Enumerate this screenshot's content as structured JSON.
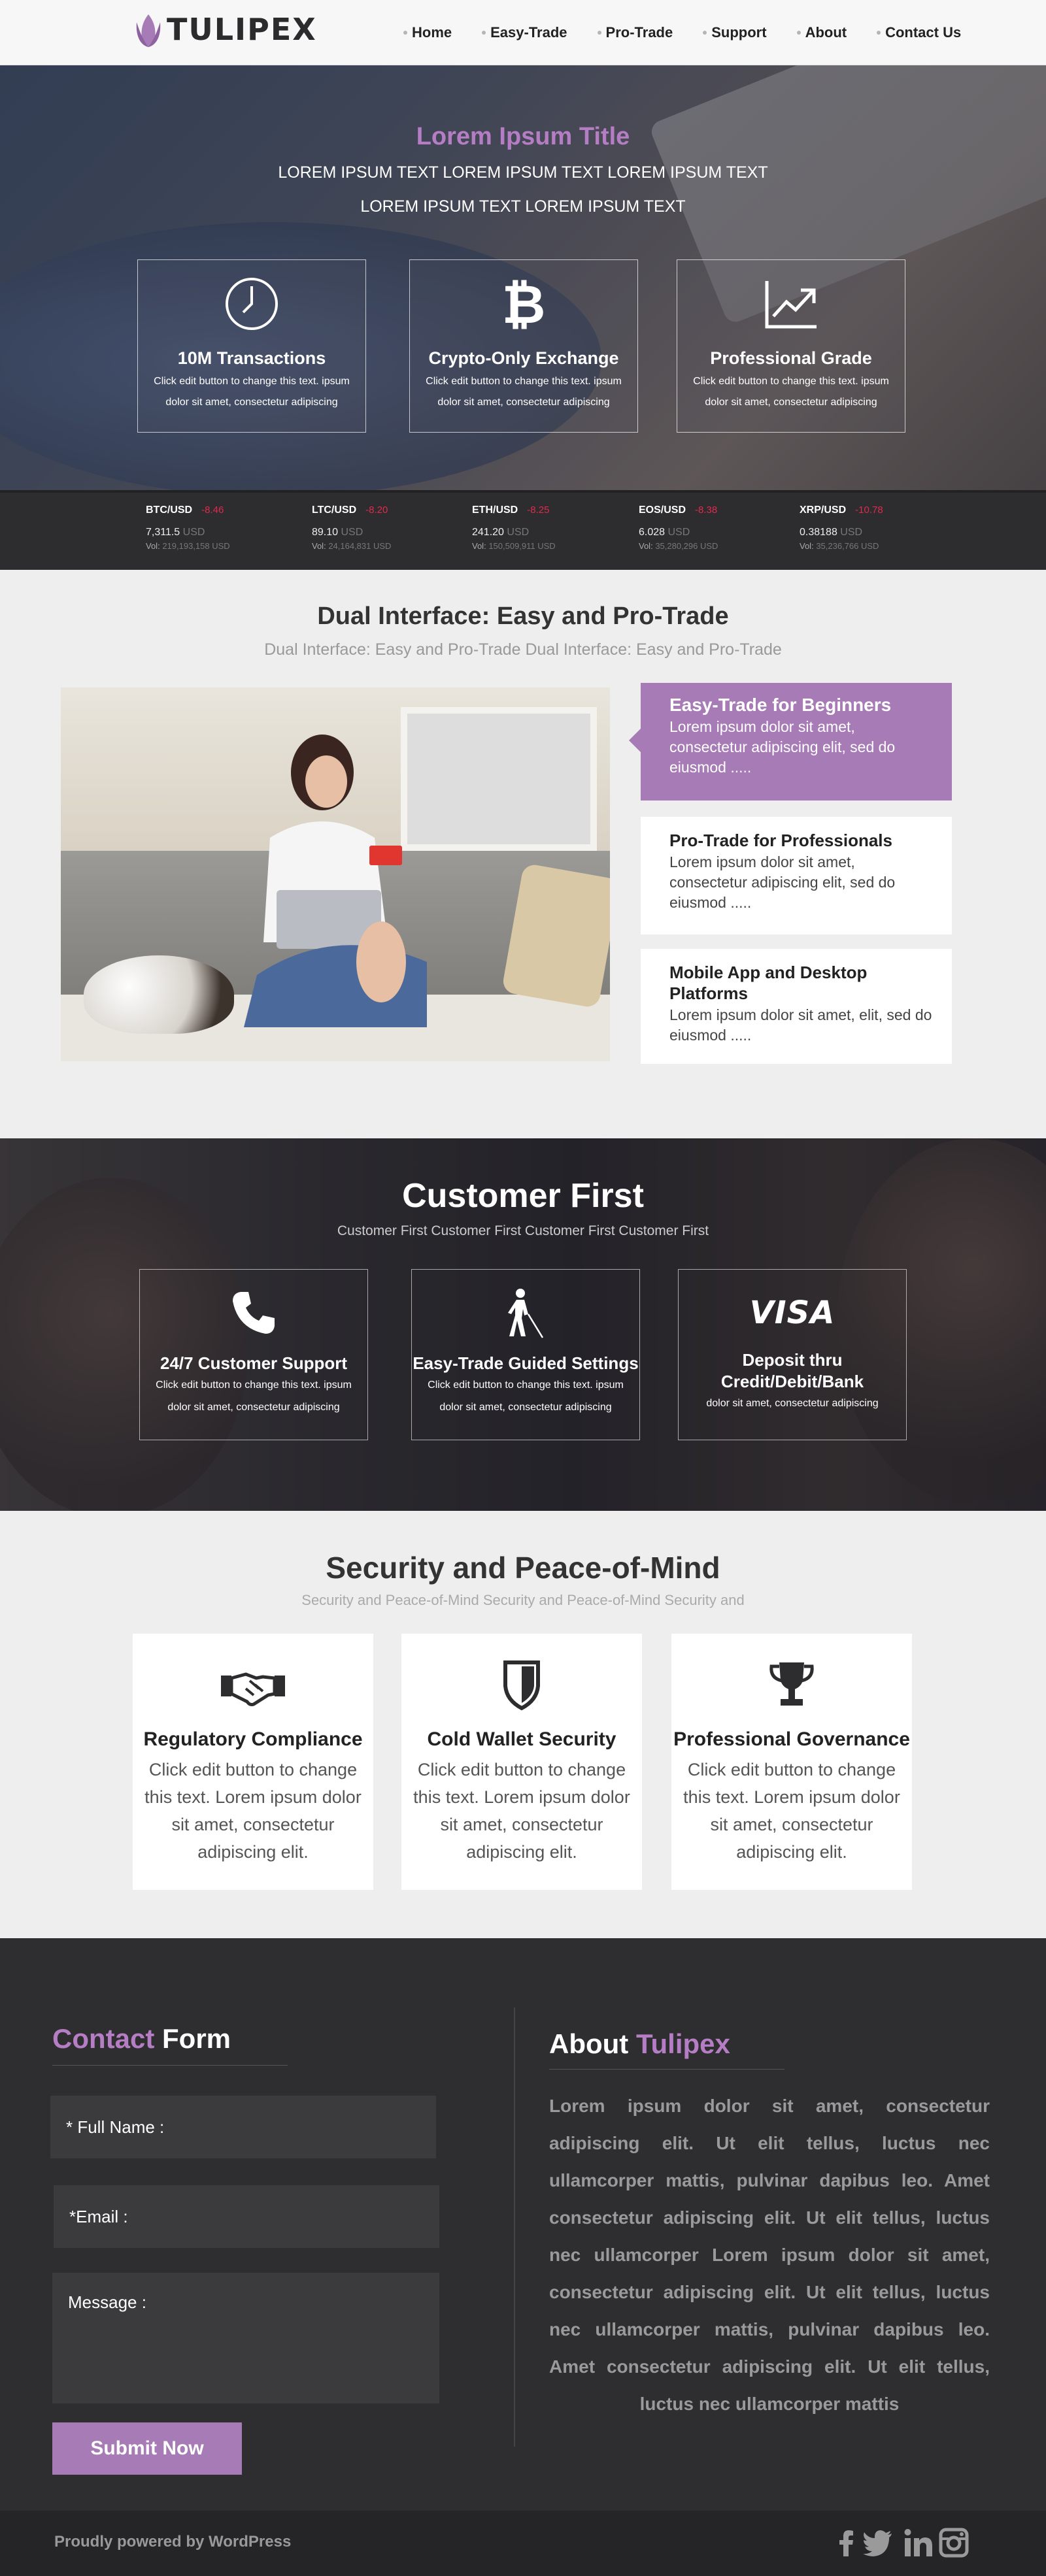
{
  "header": {
    "logo_text": "TULIPEX",
    "nav": [
      "Home",
      "Easy-Trade",
      "Pro-Trade",
      "Support",
      "About",
      "Contact Us"
    ]
  },
  "hero": {
    "title": "Lorem Ipsum Title",
    "line1": "LOREM IPSUM TEXT LOREM IPSUM TEXT LOREM IPSUM TEXT",
    "line2": "LOREM IPSUM TEXT  LOREM IPSUM TEXT",
    "features": [
      {
        "icon": "clock-icon",
        "title": "10M Transactions",
        "desc": "Click edit button to change this text. ipsum dolor sit amet, consectetur adipiscing"
      },
      {
        "icon": "bitcoin-icon",
        "title": "Crypto-Only Exchange",
        "desc": "Click edit button to change this text. ipsum dolor sit amet, consectetur adipiscing"
      },
      {
        "icon": "trending-up-icon",
        "title": "Professional Grade",
        "desc": "Click edit button to change this text. ipsum dolor sit amet, consectetur adipiscing"
      }
    ]
  },
  "ticker": [
    {
      "pair": "BTC/USD",
      "change": "-8.46",
      "price": "7,311.5",
      "unit": "USD",
      "vol_label": "Vol:",
      "volume": "219,193,158 USD"
    },
    {
      "pair": "LTC/USD",
      "change": "-8.20",
      "price": "89.10",
      "unit": "USD",
      "vol_label": "Vol:",
      "volume": "24,164,831 USD"
    },
    {
      "pair": "ETH/USD",
      "change": "-8.25",
      "price": "241.20",
      "unit": "USD",
      "vol_label": "Vol:",
      "volume": "150,509,911 USD"
    },
    {
      "pair": "EOS/USD",
      "change": "-8.38",
      "price": "6.028",
      "unit": "USD",
      "vol_label": "Vol:",
      "volume": "35,280,296 USD"
    },
    {
      "pair": "XRP/USD",
      "change": "-10.78",
      "price": "0.38188",
      "unit": "USD",
      "vol_label": "Vol:",
      "volume": "35,236,766 USD"
    }
  ],
  "dual": {
    "title": "Dual Interface: Easy and Pro-Trade",
    "subtitle": "Dual Interface: Easy and Pro-Trade Dual Interface: Easy and Pro-Trade",
    "cards": [
      {
        "title": "Easy-Trade for Beginners",
        "desc": "Lorem ipsum dolor sit amet, consectetur adipiscing elit, sed do eiusmod ....."
      },
      {
        "title": "Pro-Trade for Professionals",
        "desc": "Lorem ipsum dolor sit amet, consectetur adipiscing elit, sed do eiusmod ....."
      },
      {
        "title": "Mobile App and Desktop Platforms",
        "desc": "Lorem ipsum dolor sit amet, elit, sed do eiusmod ....."
      }
    ]
  },
  "customer_first": {
    "title": "Customer First",
    "subtitle": "Customer First Customer First Customer First Customer First",
    "boxes": [
      {
        "icon": "phone-icon",
        "title": "24/7 Customer Support",
        "desc": "Click edit button to change this text. ipsum dolor sit amet, consectetur adipiscing"
      },
      {
        "icon": "blind-person-icon",
        "title": "Easy-Trade Guided Settings",
        "desc": "Click edit button to change this text. ipsum dolor sit amet, consectetur adipiscing"
      },
      {
        "icon": "visa-icon",
        "icon_text": "VISA",
        "title": "Deposit thru Credit/Debit/Bank",
        "desc": "dolor sit amet, consectetur adipiscing"
      }
    ]
  },
  "security": {
    "title": "Security and Peace-of-Mind",
    "subtitle": "Security and Peace-of-Mind Security and Peace-of-Mind Security and",
    "cards": [
      {
        "icon": "handshake-icon",
        "title": "Regulatory Compliance",
        "desc": "Click edit button to change this text. Lorem ipsum dolor sit amet, consectetur adipiscing elit."
      },
      {
        "icon": "shield-icon",
        "title": "Cold Wallet Security",
        "desc": "Click edit button to change this text. Lorem ipsum dolor sit amet, consectetur adipiscing elit."
      },
      {
        "icon": "trophy-icon",
        "title": "Professional Governance",
        "desc": "Click edit button to change this text. Lorem ipsum dolor sit amet, consectetur adipiscing elit."
      }
    ]
  },
  "contact": {
    "heading_accent": "Contact",
    "heading_rest": " Form",
    "name_label": "* Full Name :",
    "email_label": "*Email :",
    "message_label": "Message :",
    "submit": "Submit Now"
  },
  "about": {
    "heading_plain": "About ",
    "heading_accent": "Tulipex",
    "text": "Lorem ipsum dolor sit amet, consectetur adipiscing elit. Ut elit tellus, luctus nec ullamcorper mattis, pulvinar dapibus leo. Amet consectetur adipiscing elit. Ut elit tellus, luctus nec ullamcorper  Lorem ipsum dolor sit amet, consectetur adipiscing elit. Ut elit tellus, luctus nec ullamcorper mattis, pulvinar dapibus leo. Amet consectetur adipiscing elit.  Ut elit tellus, luctus nec ullamcorper mattis"
  },
  "footer": {
    "powered": "Proudly powered by WordPress",
    "social": [
      "facebook-icon",
      "twitter-icon",
      "linkedin-icon",
      "instagram-icon"
    ]
  },
  "colors": {
    "accent": "#a77bb5",
    "dark": "#2e2e31",
    "negative": "#e0294b"
  }
}
